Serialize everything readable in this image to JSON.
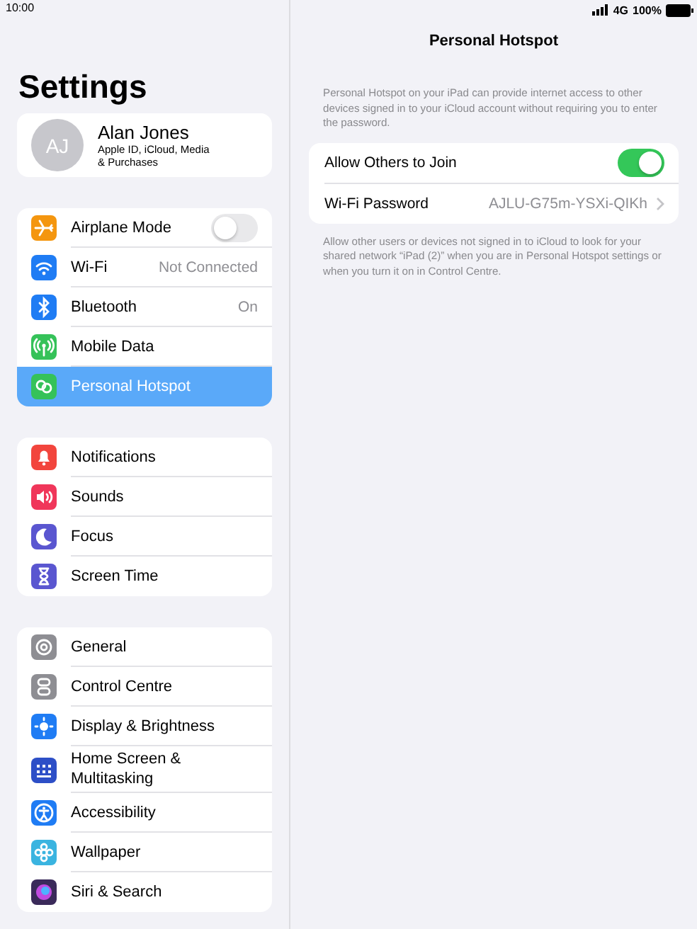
{
  "status_bar": {
    "time": "10:00",
    "network": "4G",
    "battery": "100%"
  },
  "sidebar": {
    "title": "Settings",
    "profile": {
      "initials": "AJ",
      "name": "Alan Jones",
      "subtitle": "Apple ID, iCloud, Media\n& Purchases"
    },
    "groups": [
      {
        "items": [
          {
            "label": "Airplane Mode",
            "kind": "toggle",
            "on": false,
            "selected": false,
            "color": "#f4960f"
          },
          {
            "label": "Wi-Fi",
            "kind": "value",
            "value": "Not Connected",
            "selected": false,
            "color": "#1f7cf4"
          },
          {
            "label": "Bluetooth",
            "kind": "value",
            "value": "On",
            "selected": false,
            "color": "#1f7cf4"
          },
          {
            "label": "Mobile Data",
            "kind": "plain",
            "selected": false,
            "color": "#35c259"
          },
          {
            "label": "Personal Hotspot",
            "kind": "plain",
            "selected": true,
            "color": "#35c259"
          }
        ]
      },
      {
        "items": [
          {
            "label": "Notifications",
            "kind": "plain",
            "selected": false,
            "color": "#f2453d"
          },
          {
            "label": "Sounds",
            "kind": "plain",
            "selected": false,
            "color": "#f0365a"
          },
          {
            "label": "Focus",
            "kind": "plain",
            "selected": false,
            "color": "#5a56d0"
          },
          {
            "label": "Screen Time",
            "kind": "plain",
            "selected": false,
            "color": "#5a56d0"
          }
        ]
      },
      {
        "items": [
          {
            "label": "General",
            "kind": "plain",
            "selected": false,
            "color": "#8e8e93"
          },
          {
            "label": "Control Centre",
            "kind": "plain",
            "selected": false,
            "color": "#8e8e93"
          },
          {
            "label": "Display & Brightness",
            "kind": "plain",
            "selected": false,
            "color": "#1f7cf4"
          },
          {
            "label": "Home Screen &\nMultitasking",
            "kind": "plain",
            "selected": false,
            "color": "#2d4fc7"
          },
          {
            "label": "Accessibility",
            "kind": "plain",
            "selected": false,
            "color": "#1f7cf4"
          },
          {
            "label": "Wallpaper",
            "kind": "plain",
            "selected": false,
            "color": "#3ab4e0"
          },
          {
            "label": "Siri & Search",
            "kind": "plain",
            "selected": false,
            "color": "#3a2a5a"
          }
        ]
      }
    ]
  },
  "detail": {
    "title": "Personal Hotspot",
    "intro": "Personal Hotspot on your iPad can provide internet access to other devices signed in to your iCloud account without requiring you to enter the password.",
    "rows": [
      {
        "label": "Allow Others to Join",
        "kind": "toggle",
        "on": true
      },
      {
        "label": "Wi-Fi Password",
        "kind": "value",
        "value": "AJLU-G75m-YSXi-QIKh"
      }
    ],
    "footer": "Allow other users or devices not signed in to iCloud to look for your shared network “iPad (2)” when you are in Personal Hotspot settings or when you turn it on in Control Centre."
  }
}
